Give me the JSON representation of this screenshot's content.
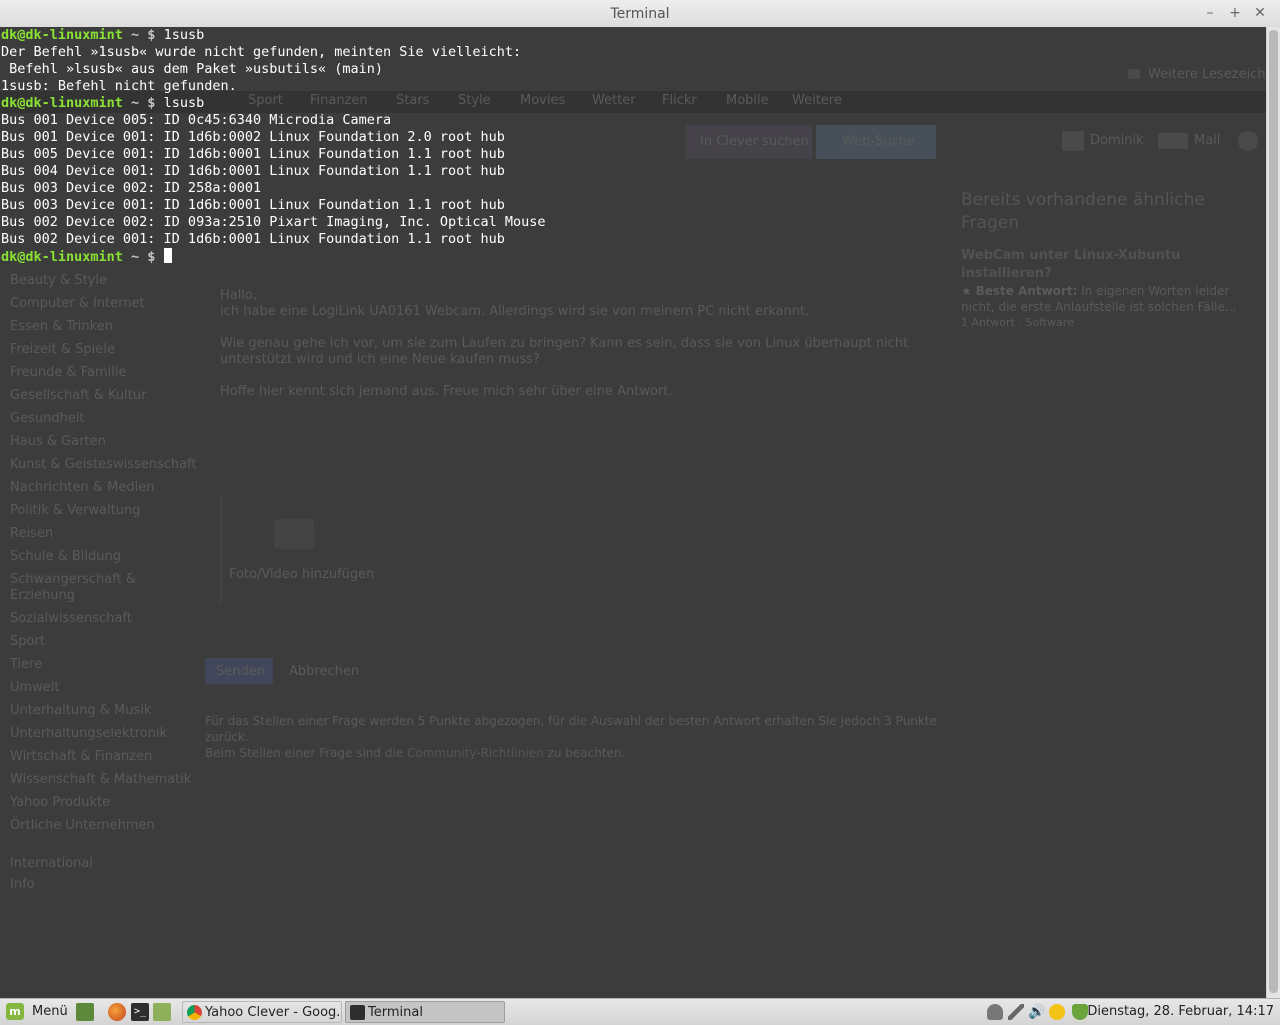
{
  "window": {
    "title": "Terminal",
    "minimize_label": "–",
    "maximize_label": "+",
    "close_label": "✕"
  },
  "terminal": {
    "prompt_user": "dk@dk-linuxmint",
    "prompt_path": "~",
    "prompt_symbol": "$",
    "lines": [
      {
        "kind": "prompt",
        "command": "1susb"
      },
      {
        "kind": "output",
        "text": "Der Befehl »1susb« wurde nicht gefunden, meinten Sie vielleicht:"
      },
      {
        "kind": "output",
        "text": " Befehl »lsusb« aus dem Paket »usbutils« (main)"
      },
      {
        "kind": "output",
        "text": "1susb: Befehl nicht gefunden."
      },
      {
        "kind": "prompt",
        "command": "lsusb"
      },
      {
        "kind": "output",
        "text": "Bus 001 Device 005: ID 0c45:6340 Microdia Camera"
      },
      {
        "kind": "output",
        "text": "Bus 001 Device 001: ID 1d6b:0002 Linux Foundation 2.0 root hub"
      },
      {
        "kind": "output",
        "text": "Bus 005 Device 001: ID 1d6b:0001 Linux Foundation 1.1 root hub"
      },
      {
        "kind": "output",
        "text": "Bus 004 Device 001: ID 1d6b:0001 Linux Foundation 1.1 root hub"
      },
      {
        "kind": "output",
        "text": "Bus 003 Device 002: ID 258a:0001"
      },
      {
        "kind": "output",
        "text": "Bus 003 Device 001: ID 1d6b:0001 Linux Foundation 1.1 root hub"
      },
      {
        "kind": "output",
        "text": "Bus 002 Device 002: ID 093a:2510 Pixart Imaging, Inc. Optical Mouse"
      },
      {
        "kind": "output",
        "text": "Bus 002 Device 001: ID 1d6b:0001 Linux Foundation 1.1 root hub"
      },
      {
        "kind": "prompt",
        "command": "",
        "cursor": true
      }
    ]
  },
  "background_page": {
    "bookmark_folder": "Weitere Lesezeichen",
    "nav_items": [
      "Sport",
      "Finanzen",
      "Stars",
      "Style",
      "Movies",
      "Wetter",
      "Flickr",
      "Mobile",
      "Weitere"
    ],
    "search_button": "In Clever suchen",
    "web_search_button": "Web-Suche",
    "user_name": "Dominik",
    "mail_label": "Mail",
    "categories": [
      "Beauty & Style",
      "Computer & Internet",
      "Essen & Trinken",
      "Freizeit & Spiele",
      "Freunde & Familie",
      "Gesellschaft & Kultur",
      "Gesundheit",
      "Haus & Garten",
      "Kunst & Geisteswissenschaft",
      "Nachrichten & Medien",
      "Politik & Verwaltung",
      "Reisen",
      "Schule & Bildung",
      "Schwangerschaft & Erziehung",
      "Sozialwissenschaft",
      "Sport",
      "Tiere",
      "Umwelt",
      "Unterhaltung & Musik",
      "Unterhaltungselektronik",
      "Wirtschaft & Finanzen",
      "Wissenschaft & Mathematik",
      "Yahoo Produkte",
      "Örtliche Unternehmen"
    ],
    "international": "International",
    "info": "Info",
    "question_greeting": "Hallo,",
    "question_line1": "ich habe eine LogiLink UA0161 Webcam. Allerdings wird sie von meinem PC nicht erkannt.",
    "question_line2": "Wie genau gehe ich vor, um sie zum Laufen zu bringen? Kann es sein, dass sie  von Linux überhaupt nicht",
    "question_line3": "unterstützt wird und ich eine Neue kaufen muss?",
    "question_line4": "Hoffe hier kennt sich jemand aus. Freue mich sehr über eine Antwort.",
    "photo_label": "Foto/Video hinzufügen",
    "send_button": "Senden",
    "cancel_link": "Abbrechen",
    "points_note": "Für das Stellen einer Frage werden 5 Punkte abgezogen, für die Auswahl der besten Antwort erhalten Sie jedoch 3 Punkte",
    "points_note2": "zurück.",
    "guidelines_prefix": "Beim Stellen einer Frage sind die",
    "guidelines_link": "Community-Richtlinien",
    "guidelines_suffix": "zu beachten.",
    "related_heading1": "Bereits vorhandene ähnliche",
    "related_heading2": "Fragen",
    "related_title1": "WebCam unter Linux-Xubuntu",
    "related_title2": "installieren?",
    "related_best_label": "Beste Antwort:",
    "related_best_text": "In eigenen Worten leider",
    "related_best_text2": "nicht, die erste Anlaufstelle ist solchen Fälle...",
    "related_meta": "1 Antwort · Software"
  },
  "taskbar": {
    "menu_label": "Menü",
    "windows": [
      {
        "label": "Yahoo Clever - Goog...",
        "active": false
      },
      {
        "label": "Terminal",
        "active": true
      }
    ],
    "clock": "Dienstag, 28. Februar, 14:17"
  },
  "colors": {
    "prompt_green": "#8ae234",
    "terminal_bg": "#3c3c3c",
    "mint_green": "#84b741"
  }
}
